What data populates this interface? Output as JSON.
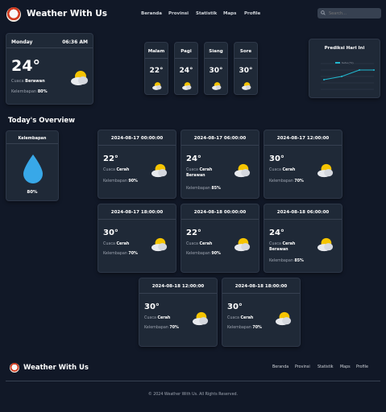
{
  "header": {
    "brand": "Weather With Us",
    "nav": [
      "Beranda",
      "Provinsi",
      "Statistik",
      "Maps",
      "Profile"
    ],
    "search_placeholder": "Search..."
  },
  "current": {
    "day": "Monday",
    "time": "06:36 AM",
    "temp": "24°",
    "condition_label": "Cuaca",
    "condition": "Berawan",
    "humidity_label": "Kelembapan",
    "humidity": "80%",
    "icon": "cloudy-sun-icon"
  },
  "time_of_day": [
    {
      "label": "Malam",
      "temp": "22°"
    },
    {
      "label": "Pagi",
      "temp": "24°"
    },
    {
      "label": "Siang",
      "temp": "30°"
    },
    {
      "label": "Sore",
      "temp": "30°"
    }
  ],
  "prediction": {
    "title": "Prediksi Hari Ini"
  },
  "overview": {
    "title": "Today's Overview",
    "humidity_card": {
      "title": "Kelembapan",
      "value": "80%"
    },
    "forecasts": [
      {
        "date": "2024-08-17 00:00:00",
        "temp": "22°",
        "cond": "Cerah",
        "hum": "90%"
      },
      {
        "date": "2024-08-17 06:00:00",
        "temp": "24°",
        "cond": "Cerah Berawan",
        "hum": "85%"
      },
      {
        "date": "2024-08-17 12:00:00",
        "temp": "30°",
        "cond": "Cerah",
        "hum": "70%"
      },
      {
        "date": "2024-08-17 18:00:00",
        "temp": "30°",
        "cond": "Cerah",
        "hum": "70%"
      },
      {
        "date": "2024-08-18 00:00:00",
        "temp": "22°",
        "cond": "Cerah",
        "hum": "90%"
      },
      {
        "date": "2024-08-18 06:00:00",
        "temp": "24°",
        "cond": "Cerah Berawan",
        "hum": "85%"
      },
      {
        "date": "2024-08-18 12:00:00",
        "temp": "30°",
        "cond": "Cerah",
        "hum": "70%"
      },
      {
        "date": "2024-08-18 18:00:00",
        "temp": "30°",
        "cond": "Cerah",
        "hum": "70%"
      }
    ],
    "cond_label": "Cuaca",
    "hum_label": "Kelembapan"
  },
  "footer": {
    "brand": "Weather With Us",
    "nav": [
      "Beranda",
      "Provinsi",
      "Statistik",
      "Maps",
      "Profile"
    ],
    "copyright": "© 2024 Weather With Us. All Rights Reserved."
  },
  "colors": {
    "background": "#111827",
    "card": "#1f2937",
    "accent": "#22b8cf",
    "drop": "#38a8e8"
  }
}
